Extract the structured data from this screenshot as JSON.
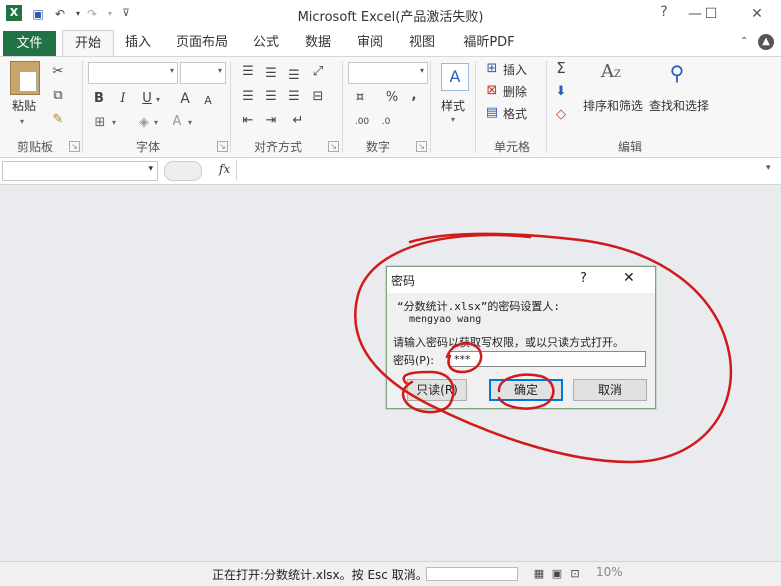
{
  "window": {
    "title": "Microsoft Excel(产品激活失败)",
    "minimize": "—",
    "maximize": "☐",
    "close": "✕"
  },
  "tabs": {
    "file": "文件",
    "items": [
      "开始",
      "插入",
      "页面布局",
      "公式",
      "数据",
      "审阅",
      "视图",
      "福昕PDF"
    ]
  },
  "ribbon": {
    "clipboard": {
      "paste": "粘贴",
      "group": "剪贴板"
    },
    "font": {
      "group": "字体",
      "bold": "B",
      "italic": "I",
      "underline": "U",
      "grow": "A",
      "shrink": "A",
      "color": "A"
    },
    "align": {
      "group": "对齐方式"
    },
    "number": {
      "group": "数字",
      "percent": "%",
      "comma": ","
    },
    "style": {
      "label": "样式"
    },
    "cells": {
      "group": "单元格",
      "insert": "插入",
      "delete": "删除",
      "format": "格式"
    },
    "edit": {
      "group": "编辑",
      "sum": "Σ",
      "sort": "排序和筛选",
      "find": "查找和选择"
    }
  },
  "formula_bar": {
    "fx": "fx"
  },
  "status": {
    "text": "正在打开:分数统计.xlsx。按 Esc 取消。",
    "zoom": "10%"
  },
  "dialog": {
    "title": "密码",
    "help": "?",
    "close": "✕",
    "line1": "“分数统计.xlsx”的密码设置人:",
    "owner": "mengyao wang",
    "prompt": "请输入密码以获取写权限，或以只读方式打开。",
    "field_label": "密码(P):",
    "field_value": "***",
    "readonly": "只读(R)",
    "ok": "确定",
    "cancel": "取消"
  },
  "colors": {
    "accent": "#217346",
    "annotation": "#d11a1a"
  }
}
